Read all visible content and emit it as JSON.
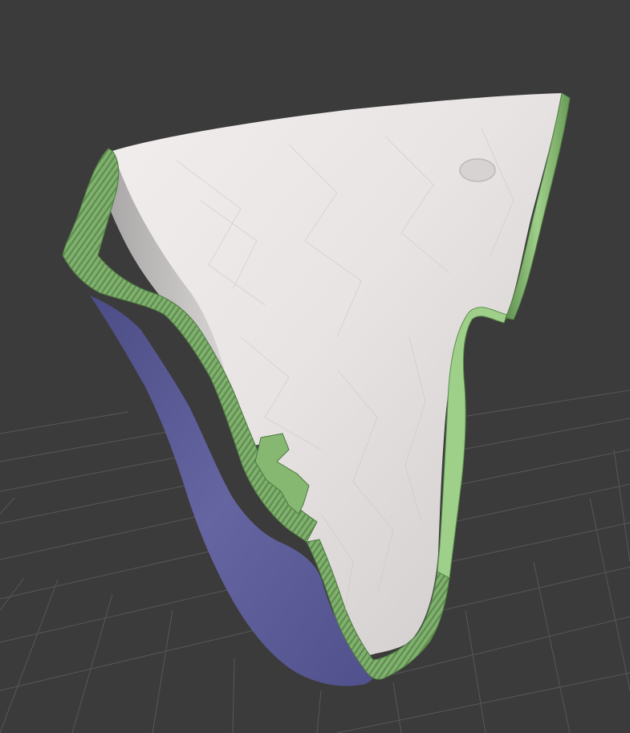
{
  "viewport": {
    "background_color": "#3b3b3b",
    "grid_color": "#575757",
    "grid_visible": true
  },
  "model": {
    "inner_surface_color": "#ebe8e8",
    "outer_surface_color": "#5a5a96",
    "cut_edge_color": "#7fb06e"
  }
}
